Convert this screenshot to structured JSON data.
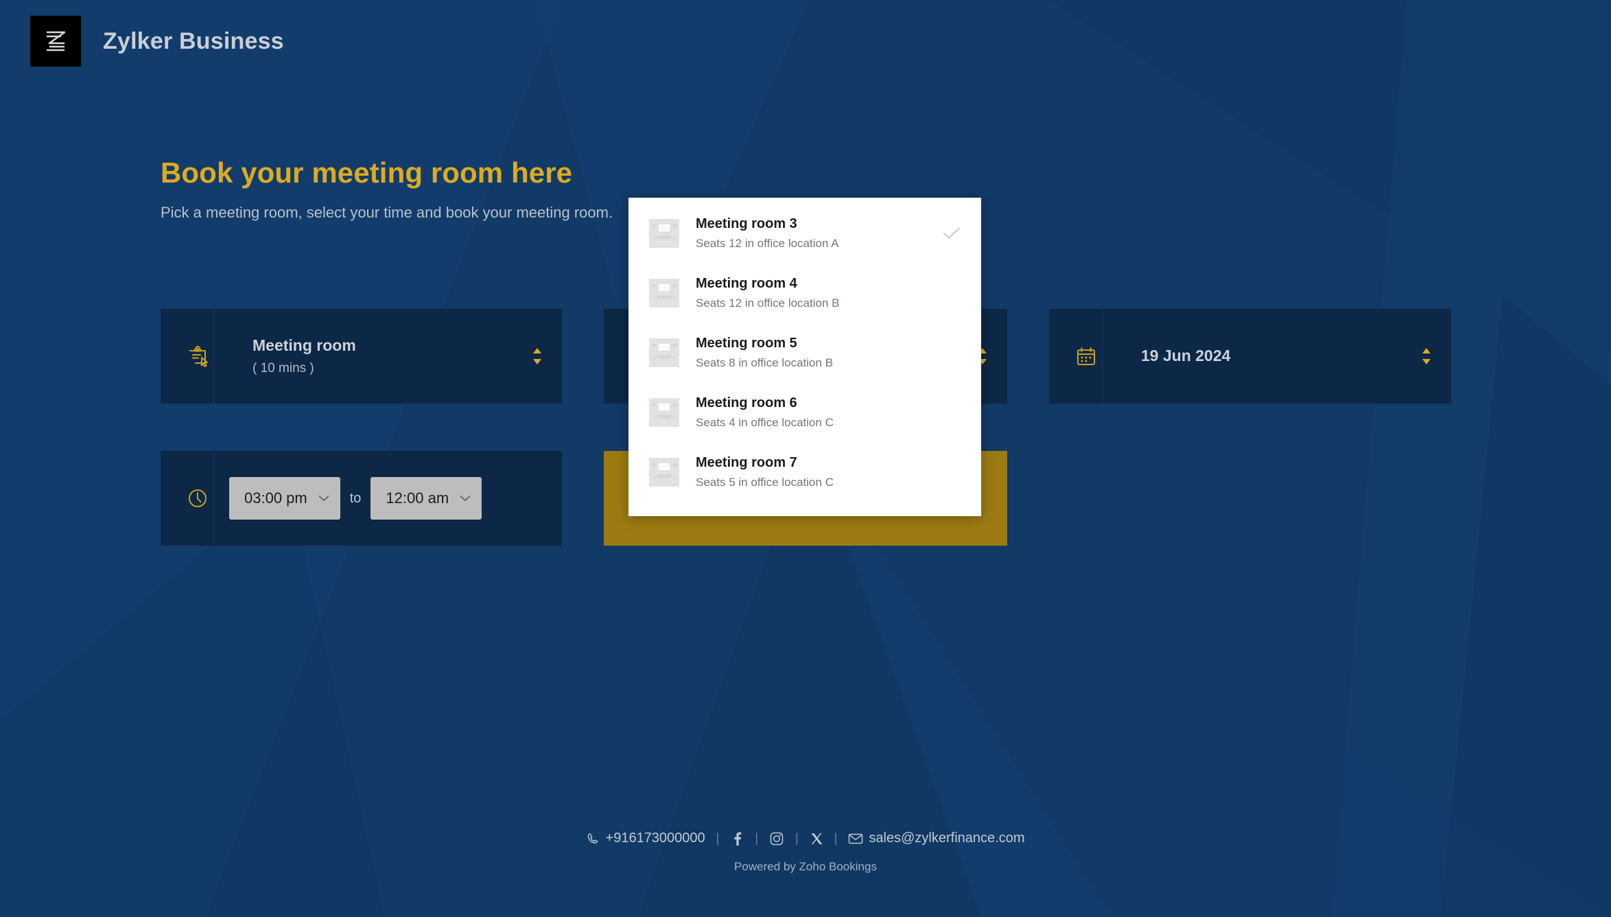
{
  "header": {
    "brand_name": "Zylker Business",
    "logo_icon": "zylker-z-logo"
  },
  "hero": {
    "title": "Book your meeting room here",
    "subtitle": "Pick a meeting room, select your time and book your meeting room."
  },
  "booking_form": {
    "service_field": {
      "icon": "clipboard-cursor-icon",
      "value": "Meeting room",
      "duration": "( 10 mins )",
      "stepper_icon": "up-down-stepper-icon"
    },
    "staff_field": {
      "icon": "user-icon",
      "value": "",
      "stepper_icon": "up-down-stepper-icon"
    },
    "date_field": {
      "icon": "calendar-icon",
      "value": "19 Jun 2024",
      "stepper_icon": "up-down-stepper-icon"
    },
    "time_field": {
      "icon": "clock-icon",
      "start_time": "03:00 pm",
      "separator_label": "to",
      "end_time": "12:00 am",
      "chevron_icon": "chevron-down-icon"
    },
    "book_button": {
      "label": ""
    }
  },
  "room_dropdown": {
    "check_icon": "check-icon",
    "thumb_icon": "meeting-room-thumbnail",
    "items": [
      {
        "name": "Meeting room 3",
        "description": "Seats 12 in office location A",
        "selected": true
      },
      {
        "name": "Meeting room 4",
        "description": "Seats 12 in office location B",
        "selected": false
      },
      {
        "name": "Meeting room 5",
        "description": "Seats 8 in office location B",
        "selected": false
      },
      {
        "name": "Meeting room 6",
        "description": "Seats 4 in office location C",
        "selected": false
      },
      {
        "name": "Meeting room 7",
        "description": "Seats 5 in office location C",
        "selected": false
      }
    ]
  },
  "footer": {
    "phone": "+916173000000",
    "phone_icon": "phone-icon",
    "facebook_icon": "facebook-icon",
    "instagram_icon": "instagram-icon",
    "x_icon": "x-twitter-icon",
    "email": "sales@zylkerfinance.com",
    "email_icon": "envelope-icon",
    "separator": "|",
    "powered_by": "Powered by Zoho Bookings"
  },
  "colors": {
    "page_background": "#123a66",
    "field_background": "#0d2746",
    "accent_gold": "#ddab1f",
    "button_gold": "#9d7b12",
    "text_light": "#ccd3da"
  }
}
